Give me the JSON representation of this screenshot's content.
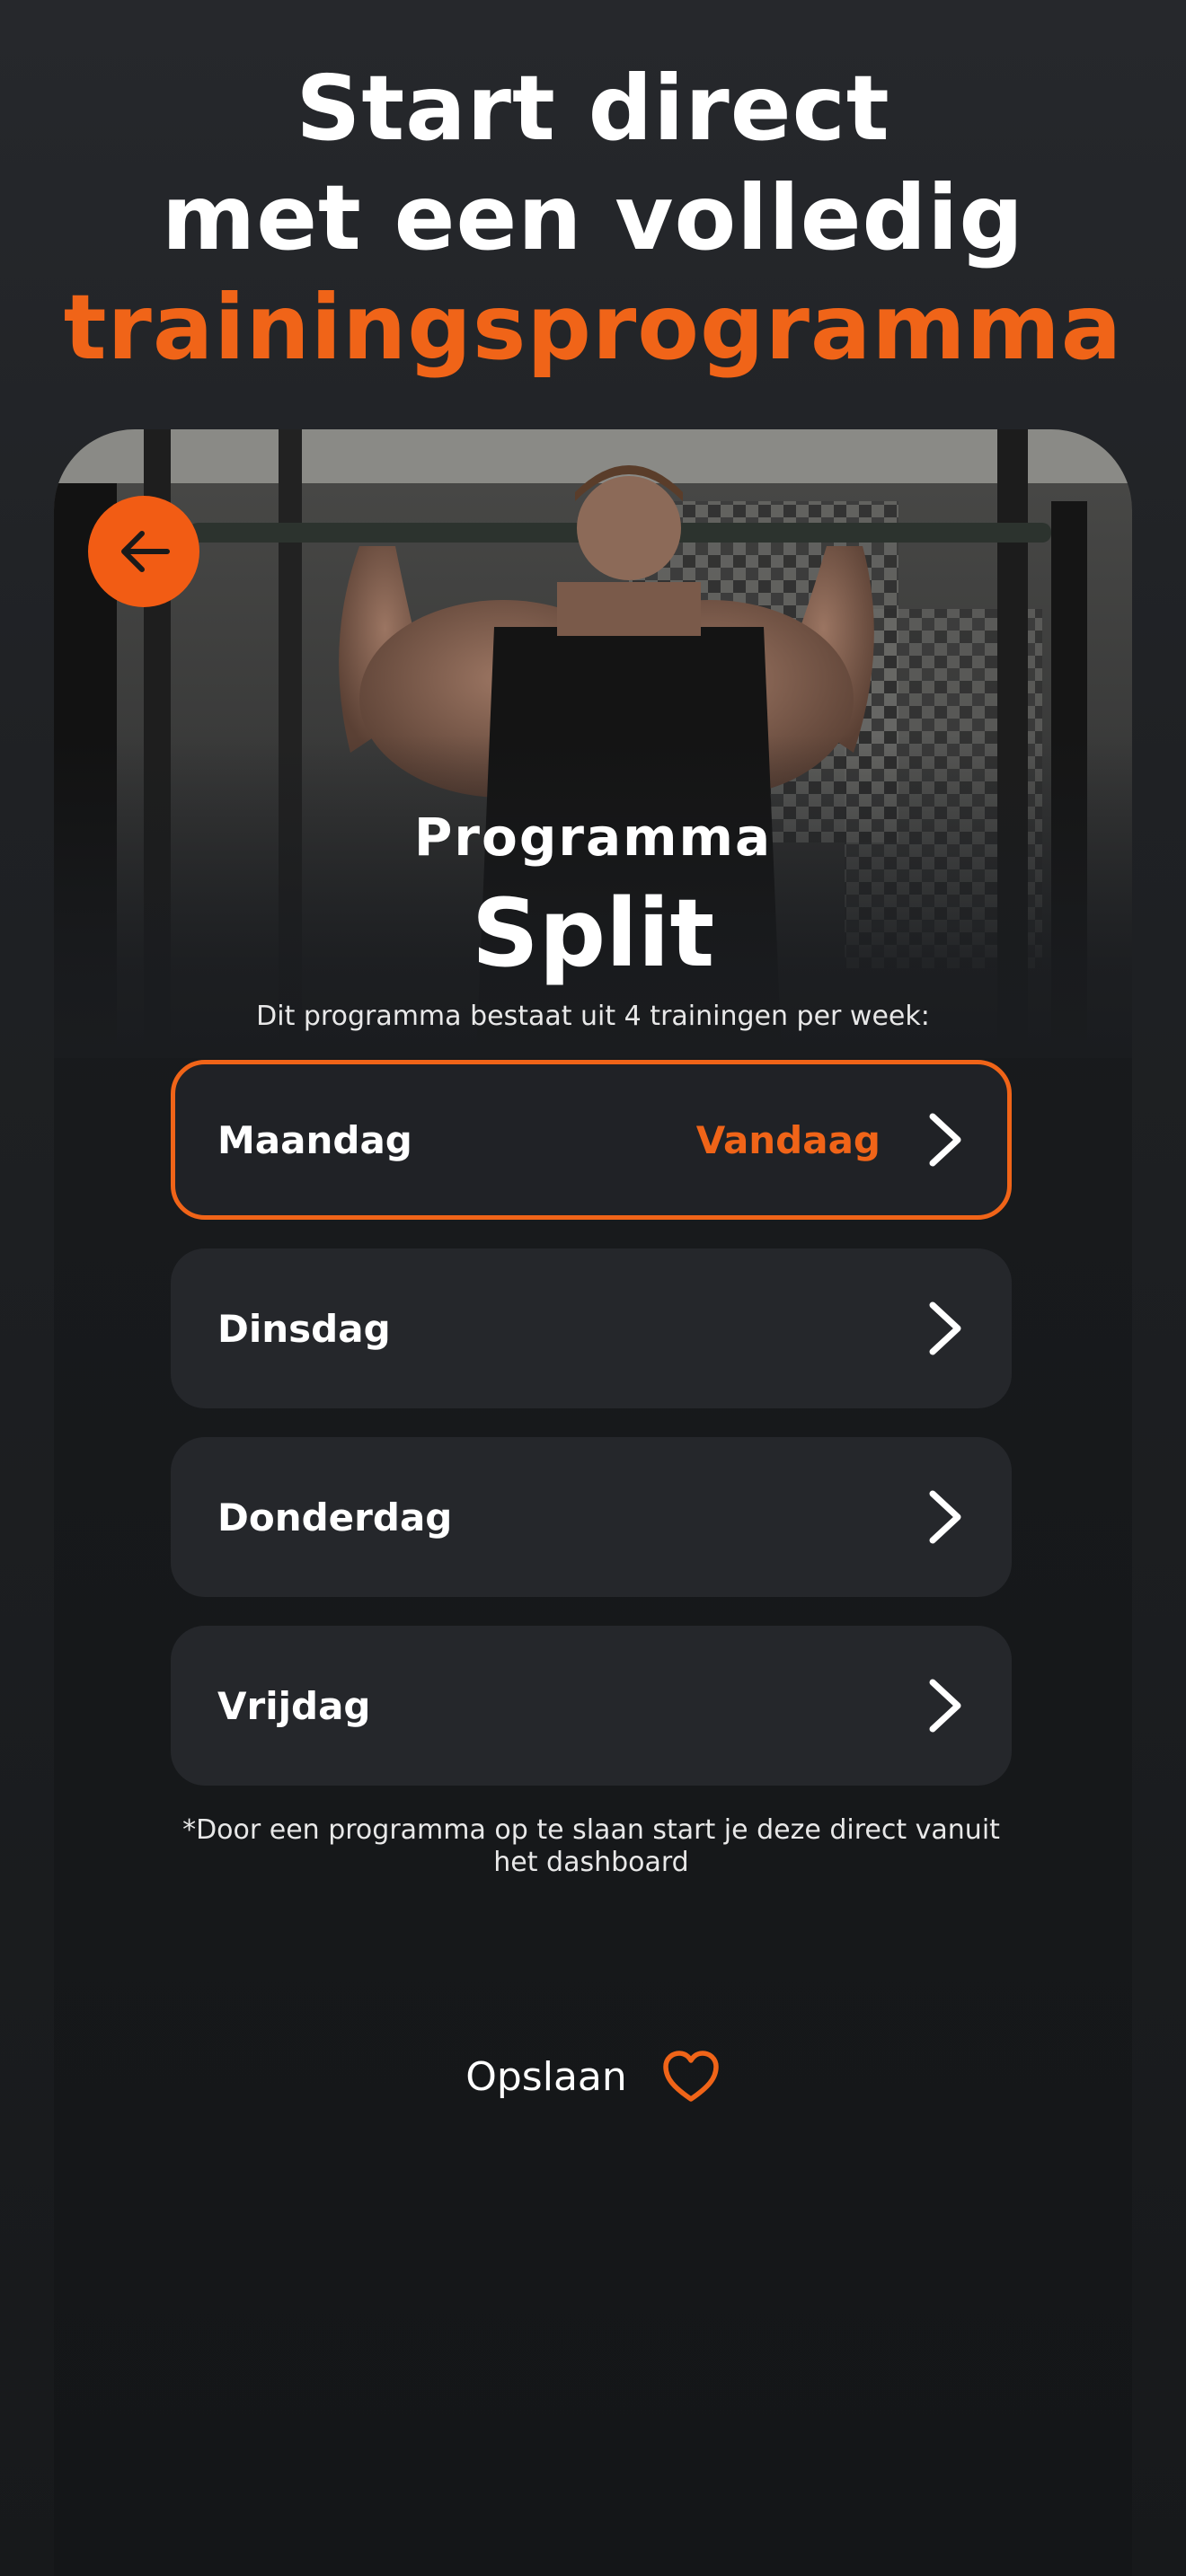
{
  "headline": {
    "line1": "Start direct",
    "line2": "met een volledig",
    "line3": "trainingsprogramma"
  },
  "back_button": {
    "icon": "arrow-left-icon"
  },
  "program": {
    "label": "Programma",
    "name": "Split",
    "description": "Dit programma bestaat uit 4 trainingen per week:"
  },
  "days": [
    {
      "label": "Maandag",
      "badge": "Vandaag",
      "active": true,
      "icon": "chevron-right-icon"
    },
    {
      "label": "Dinsdag",
      "badge": "",
      "active": false,
      "icon": "chevron-right-icon"
    },
    {
      "label": "Donderdag",
      "badge": "",
      "active": false,
      "icon": "chevron-right-icon"
    },
    {
      "label": "Vrijdag",
      "badge": "",
      "active": false,
      "icon": "chevron-right-icon"
    }
  ],
  "footnote": "*Door een programma op te slaan start je deze direct vanuit het dashboard",
  "save": {
    "label": "Opslaan",
    "icon": "heart-outline-icon"
  },
  "colors": {
    "accent": "#f06418",
    "background": "#1c1e21",
    "card": "#25272b"
  }
}
